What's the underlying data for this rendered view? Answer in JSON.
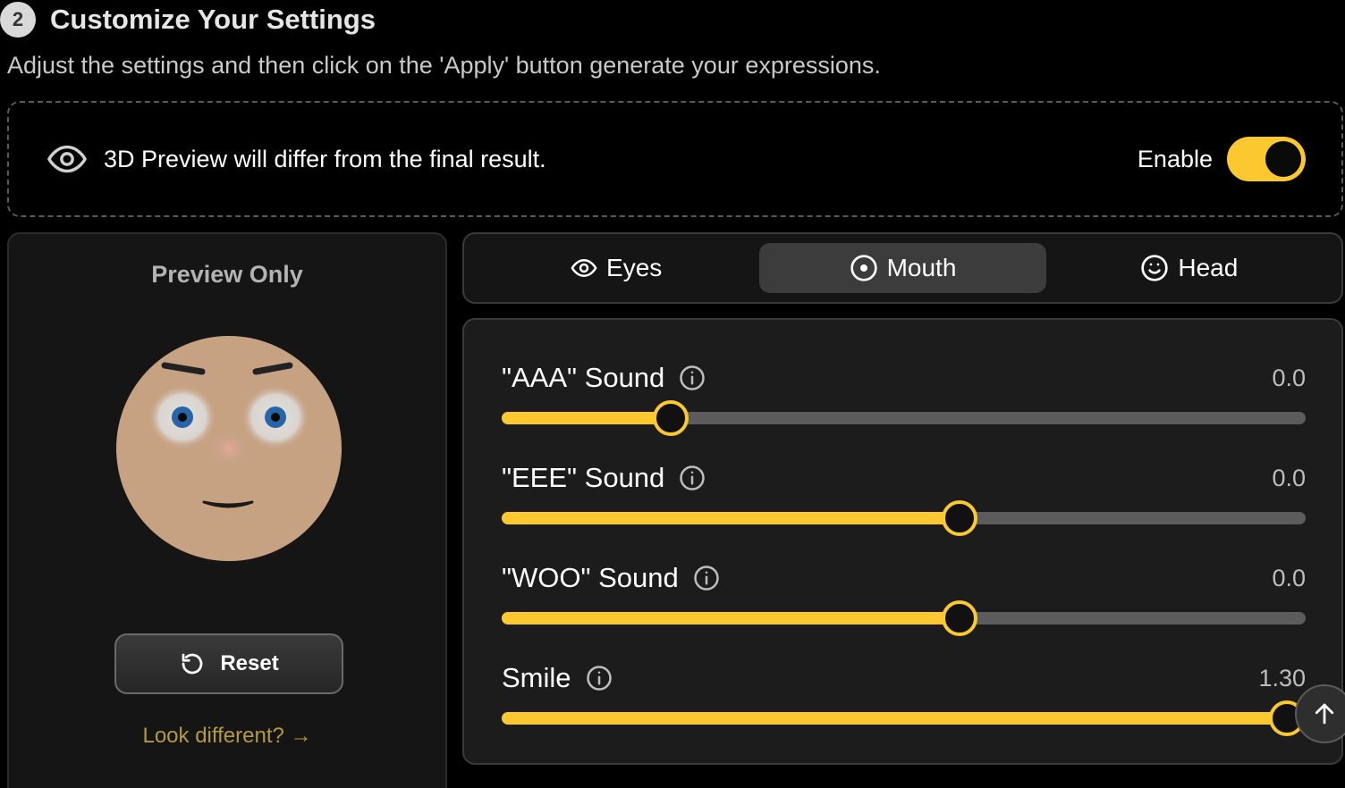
{
  "header": {
    "step_number": "2",
    "title": "Customize Your Settings",
    "subtitle": "Adjust the settings and then click on the 'Apply' button generate your expressions."
  },
  "preview_notice": {
    "icon": "eye-icon",
    "text": "3D Preview will differ from the final result.",
    "enable_label": "Enable",
    "enabled": true
  },
  "preview_panel": {
    "label": "Preview Only",
    "reset_label": "Reset",
    "look_different_label": "Look different?",
    "look_different_arrow": "→"
  },
  "tabs": [
    {
      "label": "Eyes",
      "icon": "eye-icon",
      "active": false
    },
    {
      "label": "Mouth",
      "icon": "target-circle-icon",
      "active": true
    },
    {
      "label": "Head",
      "icon": "smiley-icon",
      "active": false
    }
  ],
  "sliders": [
    {
      "label": "\"AAA\" Sound",
      "value": "0.0",
      "fill_fraction": 0.21
    },
    {
      "label": "\"EEE\" Sound",
      "value": "0.0",
      "fill_fraction": 0.57
    },
    {
      "label": "\"WOO\" Sound",
      "value": "0.0",
      "fill_fraction": 0.57
    },
    {
      "label": "Smile",
      "value": "1.30",
      "fill_fraction": 0.977
    }
  ],
  "colors": {
    "accent": "#fcc830",
    "panel": "#151515",
    "link": "#b59a3c"
  }
}
